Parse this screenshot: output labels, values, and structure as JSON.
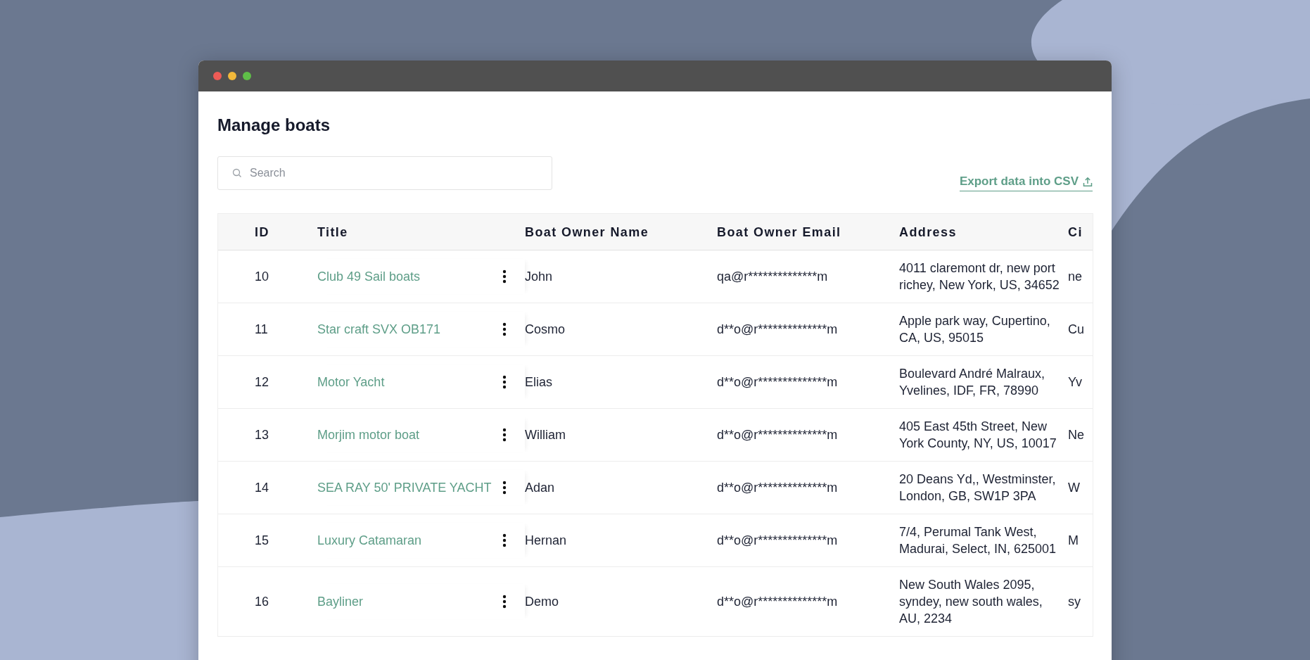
{
  "page": {
    "title": "Manage boats"
  },
  "search": {
    "placeholder": "Search"
  },
  "export_link": "Export data into CSV",
  "table": {
    "columns": [
      "ID",
      "Title",
      "Boat Owner Name",
      "Boat Owner Email",
      "Address",
      "Ci"
    ],
    "rows": [
      {
        "id": "10",
        "title": "Club 49 Sail boats",
        "owner_name": "John",
        "owner_email": "qa@r**************m",
        "address": "4011 claremont dr, new port richey, New York, US, 34652",
        "column_6": "ne"
      },
      {
        "id": "11",
        "title": "Star craft SVX OB171",
        "owner_name": "Cosmo",
        "owner_email": "d**o@r**************m",
        "address": "Apple park way, Cupertino, CA, US, 95015",
        "column_6": "Cu"
      },
      {
        "id": "12",
        "title": "Motor Yacht",
        "owner_name": "Elias",
        "owner_email": "d**o@r**************m",
        "address": "Boulevard André Malraux, Yvelines, IDF, FR, 78990",
        "column_6": "Yv"
      },
      {
        "id": "13",
        "title": "Morjim motor boat",
        "owner_name": "William",
        "owner_email": "d**o@r**************m",
        "address": "405 East 45th Street, New York County, NY, US, 10017",
        "column_6": "Ne"
      },
      {
        "id": "14",
        "title": "SEA RAY 50' PRIVATE YACHT",
        "owner_name": "Adan",
        "owner_email": "d**o@r**************m",
        "address": "20 Deans Yd,, Westminster, London, GB, SW1P 3PA",
        "column_6": "W"
      },
      {
        "id": "15",
        "title": "Luxury Catamaran",
        "owner_name": "Hernan",
        "owner_email": "d**o@r**************m",
        "address": "7/4, Perumal Tank West, Madurai, Select, IN, 625001",
        "column_6": "M"
      },
      {
        "id": "16",
        "title": "Bayliner",
        "owner_name": "Demo",
        "owner_email": "d**o@r**************m",
        "address": "New South Wales 2095, syndey, new south wales, AU, 2234",
        "column_6": "sy"
      }
    ]
  }
}
